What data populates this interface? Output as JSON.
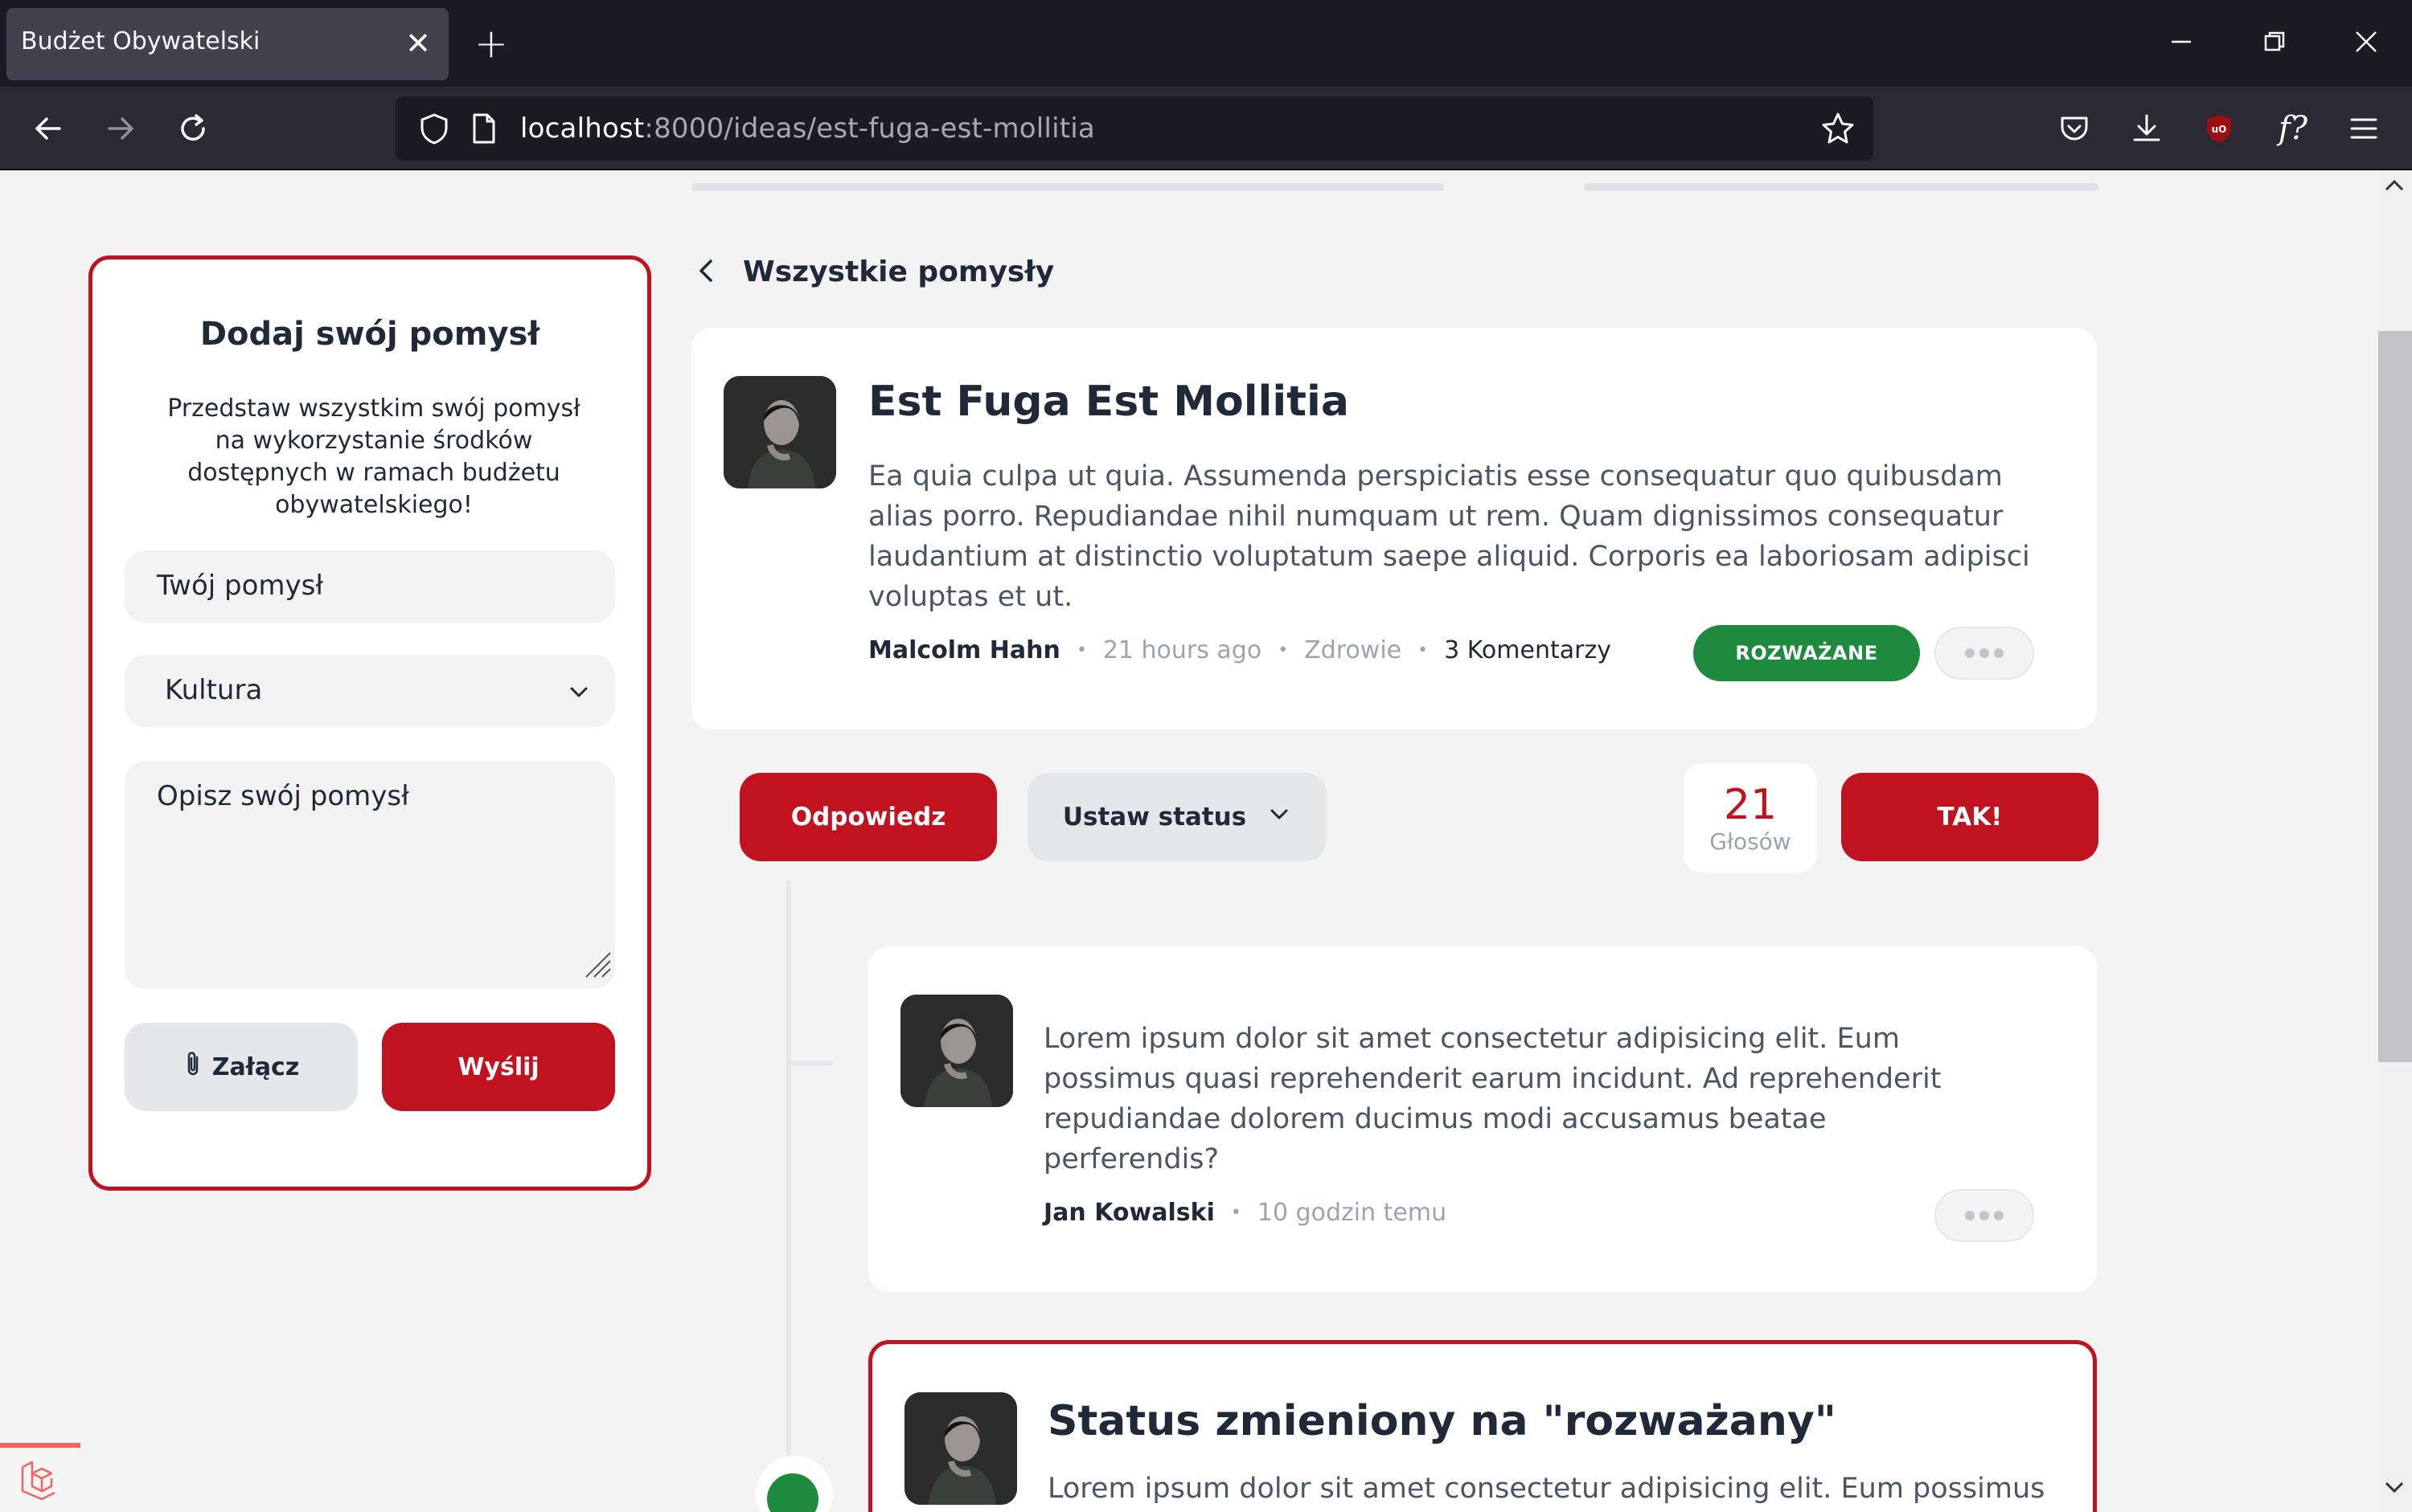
{
  "browser": {
    "tab_title": "Budżet Obywatelski",
    "url_host": "localhost",
    "url_rest": ":8000/ideas/est-fuga-est-mollitia"
  },
  "sidebar": {
    "title": "Dodaj swój pomysł",
    "description": "Przedstaw wszystkim swój pomysł na wykorzystanie środków dostępnych w ramach budżetu obywatelskiego!",
    "idea_placeholder": "Twój pomysł",
    "category_selected": "Kultura",
    "description_placeholder": "Opisz swój pomysł",
    "attach_label": "Załącz",
    "send_label": "Wyślij"
  },
  "back_link": "Wszystkie pomysły",
  "idea": {
    "title": "Est Fuga Est Mollitia",
    "body": "Ea quia culpa ut quia. Assumenda perspiciatis esse consequatur quo quibusdam alias porro. Repudiandae nihil numquam ut rem. Quam dignissimos consequatur laudantium at distinctio voluptatum saepe aliquid. Corporis ea laboriosam adipisci voluptas et ut.",
    "author": "Malcolm Hahn",
    "time": "21 hours ago",
    "category": "Zdrowie",
    "comments": "3 Komentarzy",
    "status": "ROZWAŻANE"
  },
  "actions": {
    "reply_label": "Odpowiedz",
    "set_status_label": "Ustaw status",
    "votes_count": "21",
    "votes_label": "Głosów",
    "vote_label": "TAK!"
  },
  "comment": {
    "body": "Lorem ipsum dolor sit amet consectetur adipisicing elit. Eum possimus quasi reprehenderit earum incidunt. Ad reprehenderit repudiandae dolorem ducimus modi accusamus beatae perferendis?",
    "author": "Jan Kowalski",
    "time": "10 godzin temu"
  },
  "status_change": {
    "title": "Status zmieniony na \"rozważany\"",
    "body": "Lorem ipsum dolor sit amet consectetur adipisicing elit. Eum possimus"
  },
  "colors": {
    "accent": "#c1121f",
    "status_green": "#1e8a3e",
    "page_bg": "#f3f3f4"
  }
}
